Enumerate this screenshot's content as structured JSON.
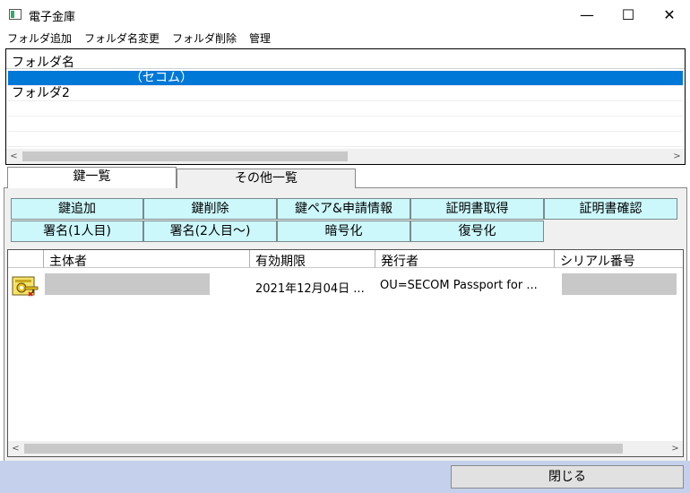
{
  "window": {
    "title": "電子金庫",
    "minimize_glyph": "—",
    "maximize_glyph": "☐",
    "close_glyph": "✕"
  },
  "menu": [
    "フォルダ追加",
    "フォルダ名変更",
    "フォルダ削除",
    "管理"
  ],
  "folders": {
    "header": "フォルダ名",
    "rows": [
      "（セコム）",
      "フォルダ2"
    ],
    "selected_index": 0
  },
  "tabs": [
    "鍵一覧",
    "その他一覧"
  ],
  "active_tab": 0,
  "actions": {
    "row1": [
      "鍵追加",
      "鍵削除",
      "鍵ペア&申請情報",
      "証明書取得",
      "証明書確認"
    ],
    "row2": [
      "署名(1人目)",
      "署名(2人目〜)",
      "暗号化",
      "復号化"
    ]
  },
  "keys": {
    "columns": [
      "主体者",
      "有効期限",
      "発行者",
      "シリアル番号"
    ],
    "rows": [
      {
        "subject": "",
        "expiry": "2021年12月04日 ...",
        "issuer": "OU=SECOM Passport for ...",
        "serial": ""
      }
    ]
  },
  "scroll_glyphs": {
    "left": "<",
    "right": ">"
  },
  "footer": {
    "close_label": "閉じる"
  },
  "colors": {
    "selection": "#0078d7",
    "action_button_bg": "#ccf8fc",
    "footer_bg": "#c4d0ec"
  },
  "icons": {
    "app": "vault-app-icon",
    "key": "key-certificate-icon"
  }
}
